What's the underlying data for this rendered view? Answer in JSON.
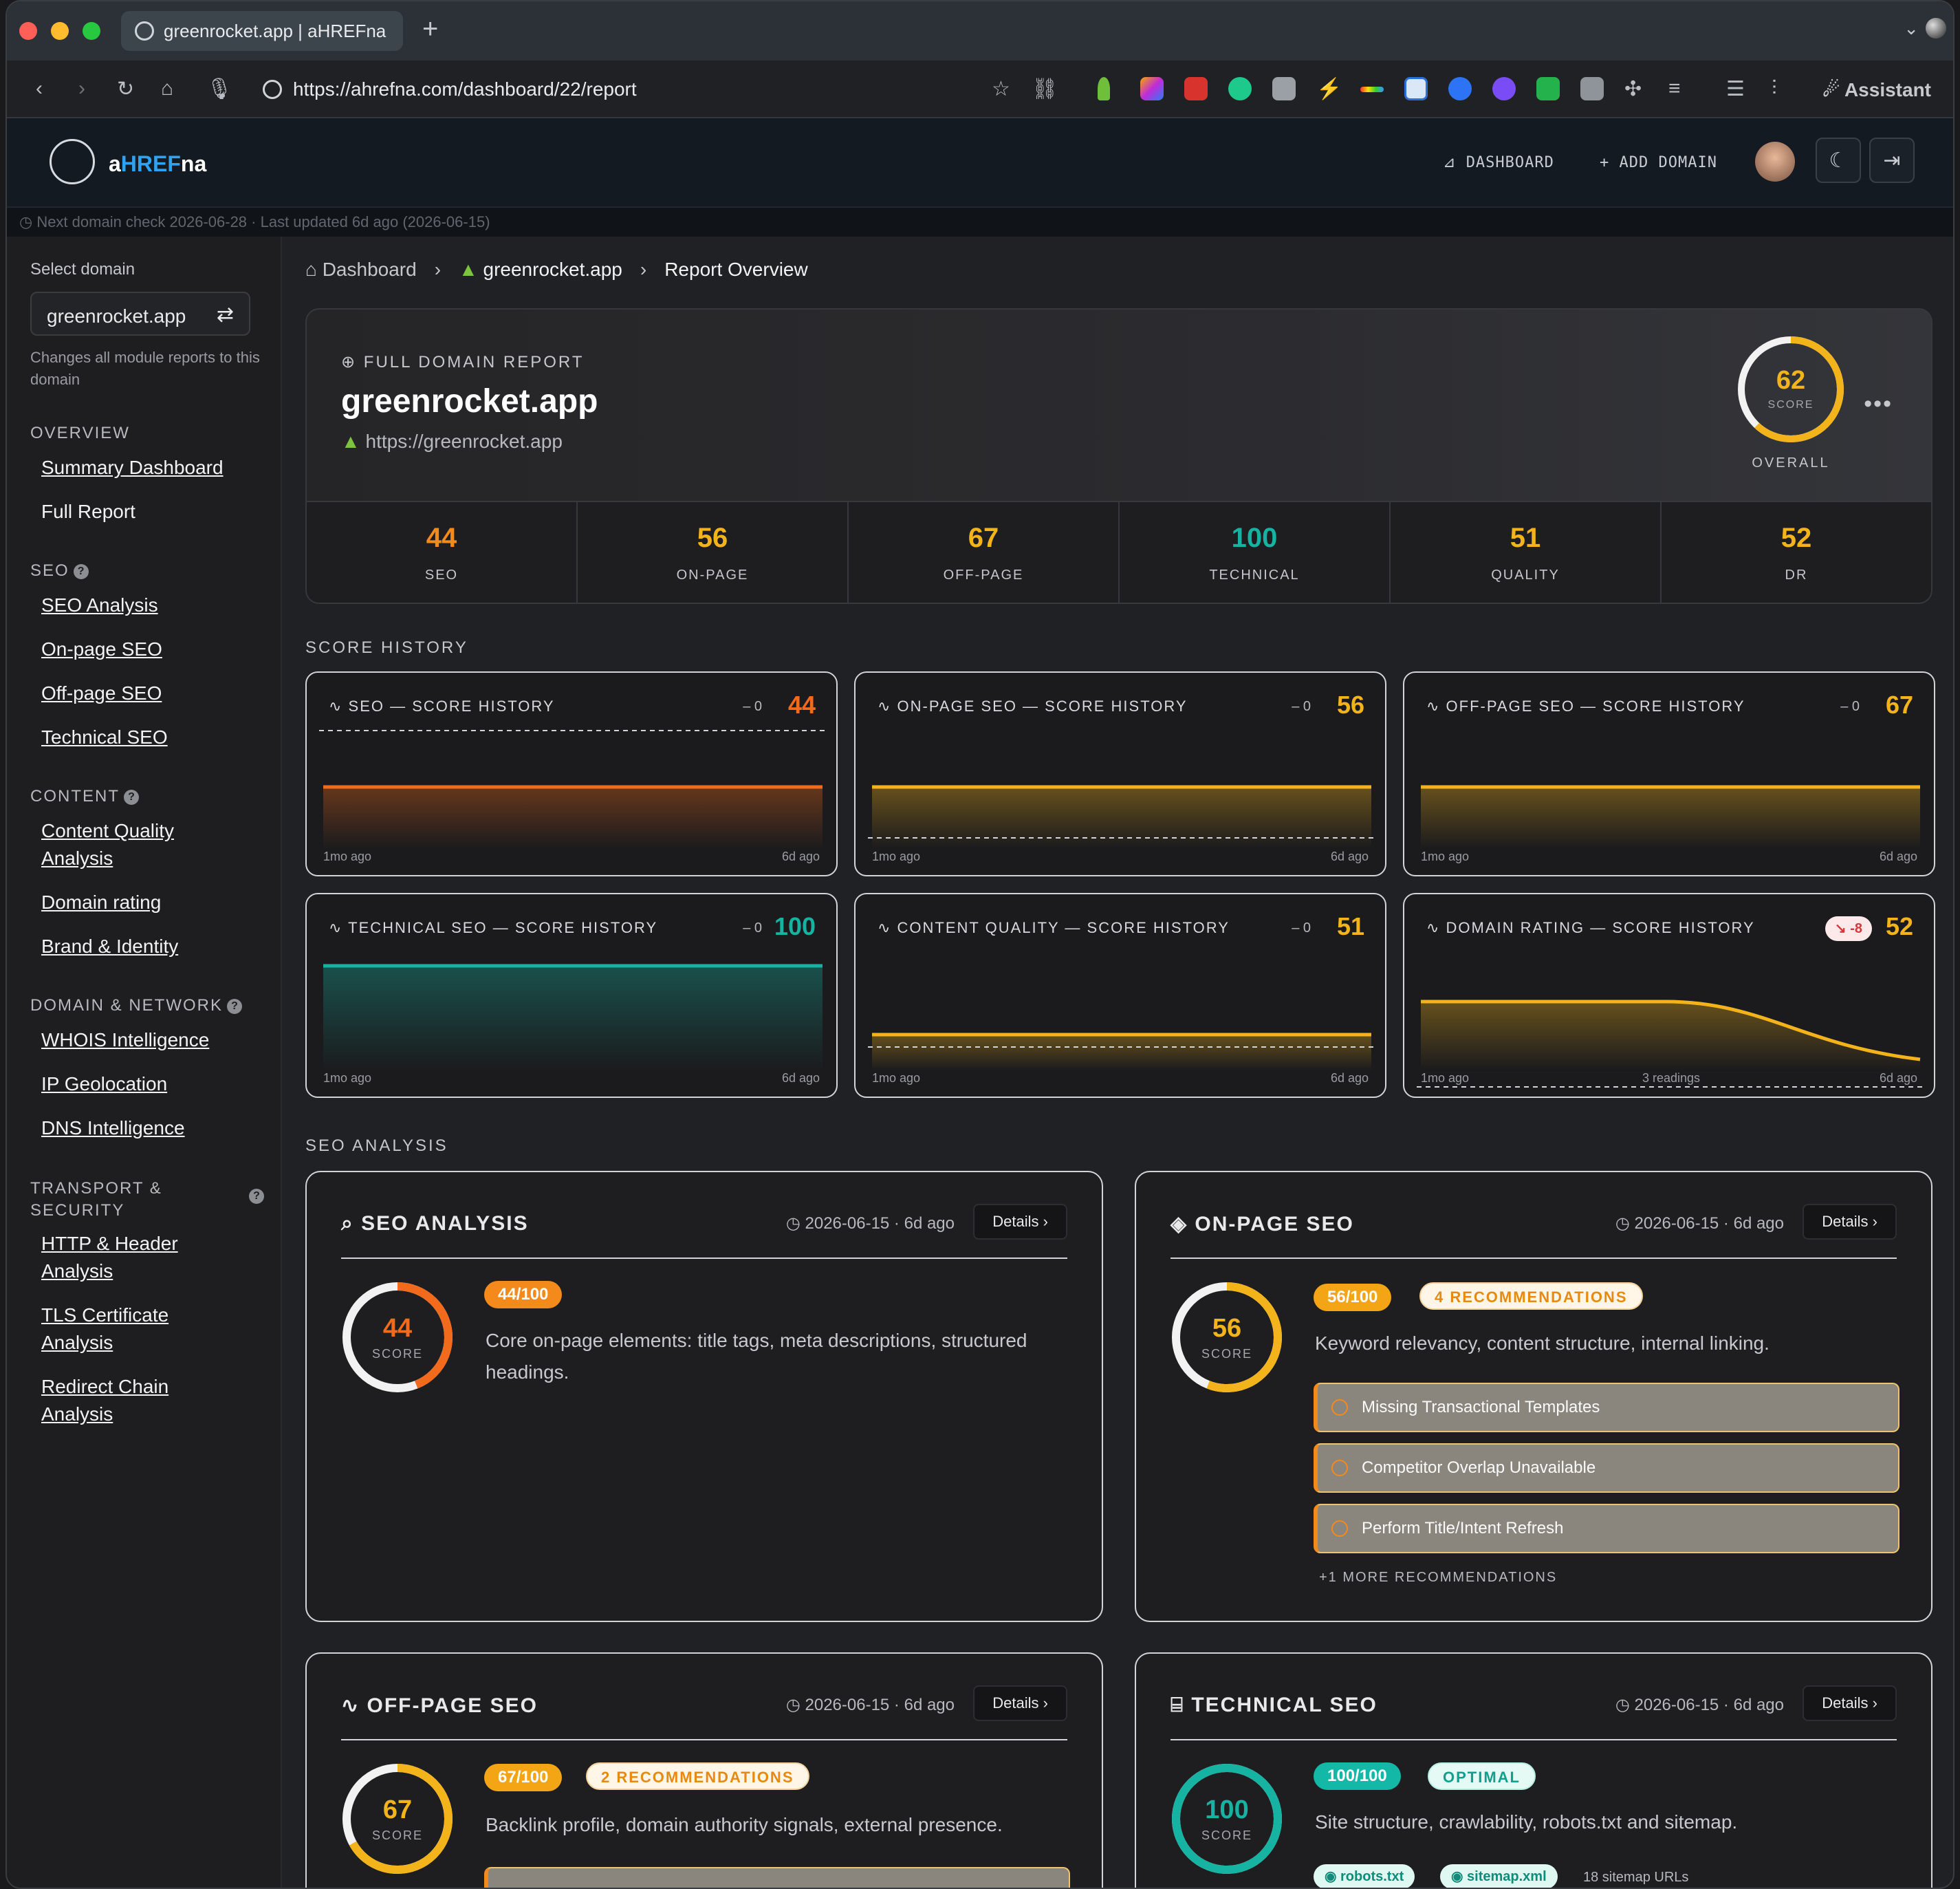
{
  "browser": {
    "tab_title": "greenrocket.app | aHREFna",
    "url": "https://ahrefna.com/dashboard/22/report",
    "assistant": "Assistant"
  },
  "header": {
    "brand_prefix": "a",
    "brand_mid": "HREF",
    "brand_suffix": "na",
    "dashboard": "DASHBOARD",
    "add_domain": "ADD DOMAIN"
  },
  "status_strip": "Next domain check 2026-06-28 · Last updated 6d ago (2026-06-15)",
  "sidebar": {
    "select_label": "Select domain",
    "selected_domain": "greenrocket.app",
    "help": "Changes all module reports to this domain",
    "sections": {
      "overview": "OVERVIEW",
      "seo": "SEO",
      "content": "CONTENT",
      "domain_network": "DOMAIN & NETWORK",
      "transport_a": "TRANSPORT &",
      "transport_b": "SECURITY"
    },
    "links": {
      "summary": "Summary Dashboard",
      "full_report": "Full Report",
      "seo_analysis": "SEO Analysis",
      "onpage": "On-page SEO",
      "offpage": "Off-page SEO",
      "technical": "Technical SEO",
      "cq_a": "Content Quality",
      "cq_b": "Analysis",
      "domain_rating": "Domain rating",
      "brand": "Brand & Identity",
      "whois": "WHOIS Intelligence",
      "ipgeo": "IP Geolocation",
      "dns": "DNS Intelligence",
      "http_a": "HTTP & Header",
      "http_b": "Analysis",
      "tls_a": "TLS Certificate",
      "tls_b": "Analysis",
      "redir_a": "Redirect Chain",
      "redir_b": "Analysis"
    }
  },
  "breadcrumb": {
    "home": "Dashboard",
    "domain": "greenrocket.app",
    "page": "Report Overview"
  },
  "hero": {
    "kicker": "FULL DOMAIN REPORT",
    "title": "greenrocket.app",
    "url": "https://greenrocket.app",
    "score": "62",
    "score_label": "SCORE",
    "overall": "OVERALL",
    "score_fraction": 0.62,
    "stats": [
      {
        "value": "44",
        "label": "SEO",
        "color": "#f48a1c"
      },
      {
        "value": "56",
        "label": "ON-PAGE",
        "color": "#f3b31a"
      },
      {
        "value": "67",
        "label": "OFF-PAGE",
        "color": "#f3b31a"
      },
      {
        "value": "100",
        "label": "TECHNICAL",
        "color": "#16b3a3"
      },
      {
        "value": "51",
        "label": "QUALITY",
        "color": "#f3b31a"
      },
      {
        "value": "52",
        "label": "DR",
        "color": "#f3b31a"
      }
    ]
  },
  "history": {
    "heading": "SCORE HISTORY",
    "cards": [
      {
        "title": "SEO — SCORE HISTORY",
        "delta": "– 0",
        "score": "44",
        "color": "#f26a1b",
        "left": "1mo ago",
        "right": "6d ago",
        "mid": ""
      },
      {
        "title": "ON-PAGE SEO — SCORE HISTORY",
        "delta": "– 0",
        "score": "56",
        "color": "#f3b31a",
        "left": "1mo ago",
        "right": "6d ago",
        "mid": ""
      },
      {
        "title": "OFF-PAGE SEO — SCORE HISTORY",
        "delta": "– 0",
        "score": "67",
        "color": "#f3b31a",
        "left": "1mo ago",
        "right": "6d ago",
        "mid": ""
      },
      {
        "title": "TECHNICAL SEO — SCORE HISTORY",
        "delta": "– 0",
        "score": "100",
        "color": "#16b3a3",
        "left": "1mo ago",
        "right": "6d ago",
        "mid": ""
      },
      {
        "title": "CONTENT QUALITY — SCORE HISTORY",
        "delta": "– 0",
        "score": "51",
        "color": "#f3b31a",
        "left": "1mo ago",
        "right": "6d ago",
        "mid": ""
      },
      {
        "title": "DOMAIN RATING — SCORE HISTORY",
        "badge": "↘ -8",
        "score": "52",
        "color": "#f3b31a",
        "left": "1mo ago",
        "right": "6d ago",
        "mid": "3 readings"
      }
    ]
  },
  "analysis": {
    "heading": "SEO ANALYSIS",
    "seo": {
      "title": "SEO ANALYSIS",
      "date": "2026-06-15 · 6d ago",
      "details": "Details",
      "score": "44",
      "score_label": "SCORE",
      "pill": "44/100",
      "desc": "Core on-page elements: title tags, meta descriptions, structured headings.",
      "fraction": 0.44
    },
    "onpage": {
      "title": "ON-PAGE SEO",
      "date": "2026-06-15 · 6d ago",
      "details": "Details",
      "score": "56",
      "score_label": "SCORE",
      "pill": "56/100",
      "recs_pill": "4 RECOMMENDATIONS",
      "desc": "Keyword relevancy, content structure, internal linking.",
      "recs": [
        "Missing Transactional Templates",
        "Competitor Overlap Unavailable",
        "Perform Title/Intent Refresh"
      ],
      "more": "+1 MORE RECOMMENDATIONS",
      "fraction": 0.56
    },
    "offpage": {
      "title": "OFF-PAGE SEO",
      "date": "2026-06-15 · 6d ago",
      "details": "Details",
      "score": "67",
      "score_label": "SCORE",
      "pill": "67/100",
      "recs_pill": "2 RECOMMENDATIONS",
      "desc": "Backlink profile, domain authority signals, external presence.",
      "fraction": 0.67
    },
    "technical": {
      "title": "TECHNICAL SEO",
      "date": "2026-06-15 · 6d ago",
      "details": "Details",
      "score": "100",
      "score_label": "SCORE",
      "pill": "100/100",
      "status_pill": "OPTIMAL",
      "desc": "Site structure, crawlability, robots.txt and sitemap.",
      "chips": [
        "robots.txt",
        "sitemap.xml"
      ],
      "sitemap_urls": "18 sitemap URLs",
      "fraction": 1.0
    }
  }
}
